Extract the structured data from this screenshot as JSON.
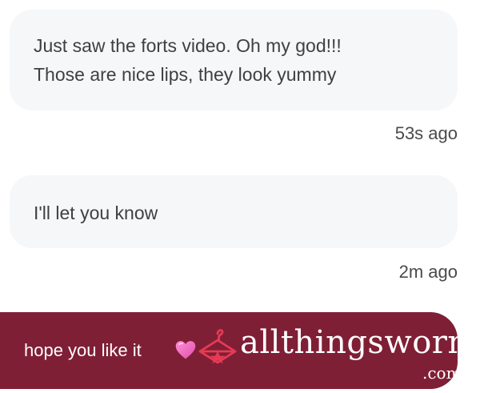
{
  "messages": [
    {
      "line1": "Just saw the forts video. Oh my god!!!",
      "line2": "Those are nice lips, they look yummy",
      "time": "53s ago"
    },
    {
      "line1": "I'll let you know",
      "time": "2m ago"
    }
  ],
  "outgoing": {
    "text": "hope you like it",
    "heart_icon": "heart-icon",
    "heart_color": "#f06ac0"
  },
  "watermark": {
    "brand": "allthingsworn",
    "suffix": ".com",
    "icon": "hanger-icon",
    "icon_color": "#e63a55"
  },
  "colors": {
    "incoming_bubble": "#f6f7f9",
    "outgoing_bubble": "#7f1f35"
  }
}
